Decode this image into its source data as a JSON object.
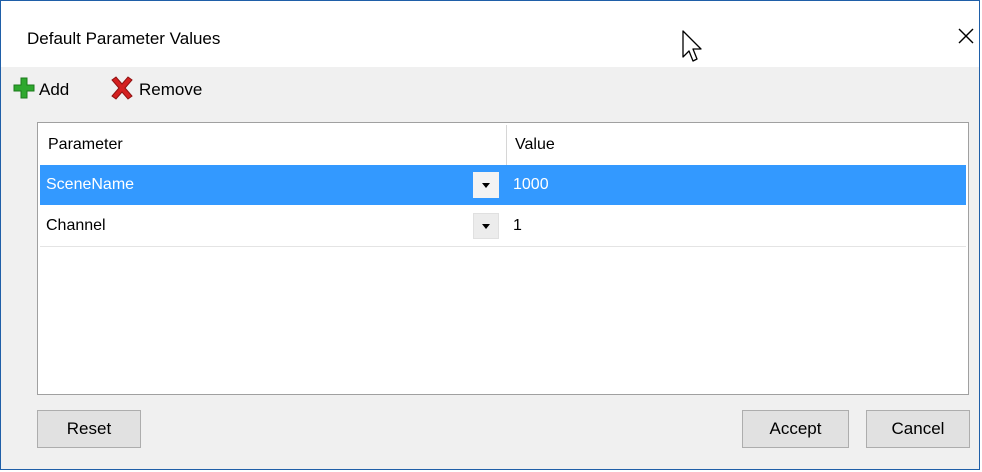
{
  "window": {
    "title": "Default Parameter Values"
  },
  "toolbar": {
    "add_label": "Add",
    "remove_label": "Remove"
  },
  "table": {
    "columns": [
      "Parameter",
      "Value"
    ],
    "rows": [
      {
        "parameter": "SceneName",
        "value": "1000",
        "selected": true
      },
      {
        "parameter": "Channel",
        "value": "1",
        "selected": false
      }
    ]
  },
  "buttons": {
    "reset": "Reset",
    "accept": "Accept",
    "cancel": "Cancel"
  },
  "colors": {
    "selection": "#3399ff",
    "border": "#1f5fa8",
    "add_icon": "#2ea82e",
    "remove_icon": "#d42020"
  },
  "icons": {
    "add": "green-plus-icon",
    "remove": "red-x-icon",
    "close": "close-icon",
    "cursor": "mouse-pointer-icon"
  }
}
